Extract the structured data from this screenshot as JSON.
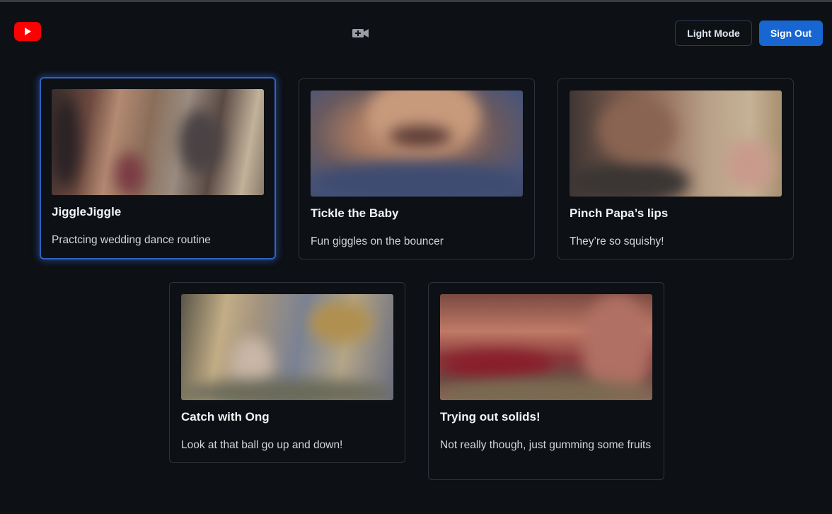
{
  "header": {
    "logo_icon": "youtube-logo-icon",
    "upload_icon": "video-camera-add-icon",
    "light_mode_label": "Light Mode",
    "sign_out_label": "Sign Out",
    "accent_color": "#1766d1",
    "logo_color": "#ff0000"
  },
  "videos": [
    {
      "title": "JiggleJiggle",
      "description": "Practcing wedding dance routine",
      "focused": true
    },
    {
      "title": "Tickle the Baby",
      "description": "Fun giggles on the bouncer",
      "focused": false
    },
    {
      "title": "Pinch Papa’s lips",
      "description": "They’re so squishy!",
      "focused": false
    },
    {
      "title": "Catch with Ong",
      "description": "Look at that ball go up and down!",
      "focused": false
    },
    {
      "title": "Trying out solids!",
      "description": "Not really though, just gumming some fruits",
      "focused": false
    }
  ]
}
